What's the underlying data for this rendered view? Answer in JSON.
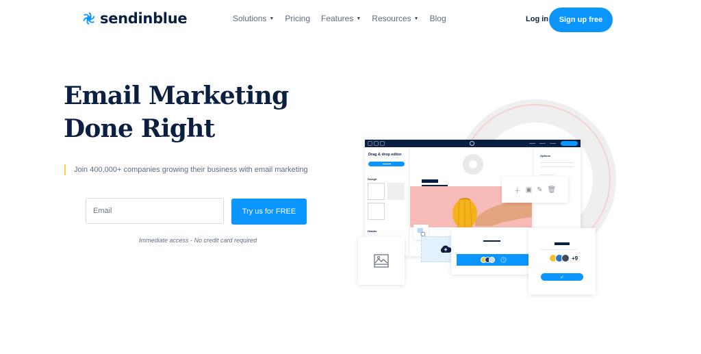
{
  "header": {
    "brand": "sendinblue",
    "nav": [
      {
        "label": "Solutions",
        "has_dropdown": true
      },
      {
        "label": "Pricing",
        "has_dropdown": false
      },
      {
        "label": "Features",
        "has_dropdown": true
      },
      {
        "label": "Resources",
        "has_dropdown": true
      },
      {
        "label": "Blog",
        "has_dropdown": false
      }
    ],
    "login_label": "Log in",
    "signup_label": "Sign up free"
  },
  "hero": {
    "title": "Email Marketing Done Right",
    "subline": "Join 400,000+ companies growing their business with email marketing",
    "email_placeholder": "Email",
    "email_value": "",
    "cta_label": "Try us for FREE",
    "note": "Immediate access - No credit card required"
  },
  "illustration": {
    "editor_title": "Drag & drop editor",
    "design_label": "Design",
    "header_label": "Header",
    "options_label": "Options",
    "toolbar_icons": [
      "plus-icon",
      "duplicate-icon",
      "pencil-icon",
      "trash-icon"
    ],
    "extra_recipients": "+9"
  },
  "colors": {
    "brand_blue": "#0b96ff",
    "navy": "#0b1f41",
    "accent_yellow": "#ffd43b",
    "pink": "#f7bcb8"
  }
}
